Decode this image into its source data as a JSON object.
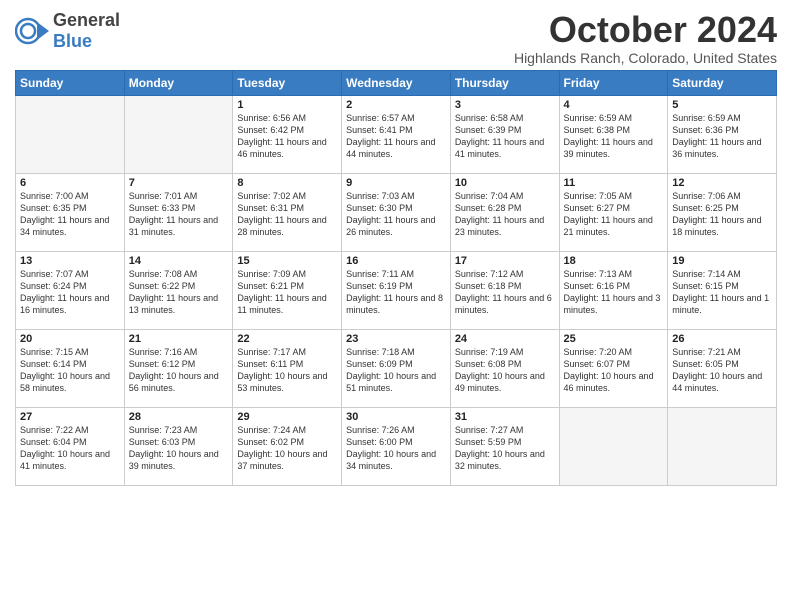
{
  "header": {
    "logo_general": "General",
    "logo_blue": "Blue",
    "month_title": "October 2024",
    "location": "Highlands Ranch, Colorado, United States"
  },
  "days_of_week": [
    "Sunday",
    "Monday",
    "Tuesday",
    "Wednesday",
    "Thursday",
    "Friday",
    "Saturday"
  ],
  "weeks": [
    [
      {
        "day": "",
        "empty": true
      },
      {
        "day": "",
        "empty": true
      },
      {
        "day": "1",
        "sunrise": "6:56 AM",
        "sunset": "6:42 PM",
        "daylight": "11 hours and 46 minutes."
      },
      {
        "day": "2",
        "sunrise": "6:57 AM",
        "sunset": "6:41 PM",
        "daylight": "11 hours and 44 minutes."
      },
      {
        "day": "3",
        "sunrise": "6:58 AM",
        "sunset": "6:39 PM",
        "daylight": "11 hours and 41 minutes."
      },
      {
        "day": "4",
        "sunrise": "6:59 AM",
        "sunset": "6:38 PM",
        "daylight": "11 hours and 39 minutes."
      },
      {
        "day": "5",
        "sunrise": "6:59 AM",
        "sunset": "6:36 PM",
        "daylight": "11 hours and 36 minutes."
      }
    ],
    [
      {
        "day": "6",
        "sunrise": "7:00 AM",
        "sunset": "6:35 PM",
        "daylight": "11 hours and 34 minutes."
      },
      {
        "day": "7",
        "sunrise": "7:01 AM",
        "sunset": "6:33 PM",
        "daylight": "11 hours and 31 minutes."
      },
      {
        "day": "8",
        "sunrise": "7:02 AM",
        "sunset": "6:31 PM",
        "daylight": "11 hours and 28 minutes."
      },
      {
        "day": "9",
        "sunrise": "7:03 AM",
        "sunset": "6:30 PM",
        "daylight": "11 hours and 26 minutes."
      },
      {
        "day": "10",
        "sunrise": "7:04 AM",
        "sunset": "6:28 PM",
        "daylight": "11 hours and 23 minutes."
      },
      {
        "day": "11",
        "sunrise": "7:05 AM",
        "sunset": "6:27 PM",
        "daylight": "11 hours and 21 minutes."
      },
      {
        "day": "12",
        "sunrise": "7:06 AM",
        "sunset": "6:25 PM",
        "daylight": "11 hours and 18 minutes."
      }
    ],
    [
      {
        "day": "13",
        "sunrise": "7:07 AM",
        "sunset": "6:24 PM",
        "daylight": "11 hours and 16 minutes."
      },
      {
        "day": "14",
        "sunrise": "7:08 AM",
        "sunset": "6:22 PM",
        "daylight": "11 hours and 13 minutes."
      },
      {
        "day": "15",
        "sunrise": "7:09 AM",
        "sunset": "6:21 PM",
        "daylight": "11 hours and 11 minutes."
      },
      {
        "day": "16",
        "sunrise": "7:11 AM",
        "sunset": "6:19 PM",
        "daylight": "11 hours and 8 minutes."
      },
      {
        "day": "17",
        "sunrise": "7:12 AM",
        "sunset": "6:18 PM",
        "daylight": "11 hours and 6 minutes."
      },
      {
        "day": "18",
        "sunrise": "7:13 AM",
        "sunset": "6:16 PM",
        "daylight": "11 hours and 3 minutes."
      },
      {
        "day": "19",
        "sunrise": "7:14 AM",
        "sunset": "6:15 PM",
        "daylight": "11 hours and 1 minute."
      }
    ],
    [
      {
        "day": "20",
        "sunrise": "7:15 AM",
        "sunset": "6:14 PM",
        "daylight": "10 hours and 58 minutes."
      },
      {
        "day": "21",
        "sunrise": "7:16 AM",
        "sunset": "6:12 PM",
        "daylight": "10 hours and 56 minutes."
      },
      {
        "day": "22",
        "sunrise": "7:17 AM",
        "sunset": "6:11 PM",
        "daylight": "10 hours and 53 minutes."
      },
      {
        "day": "23",
        "sunrise": "7:18 AM",
        "sunset": "6:09 PM",
        "daylight": "10 hours and 51 minutes."
      },
      {
        "day": "24",
        "sunrise": "7:19 AM",
        "sunset": "6:08 PM",
        "daylight": "10 hours and 49 minutes."
      },
      {
        "day": "25",
        "sunrise": "7:20 AM",
        "sunset": "6:07 PM",
        "daylight": "10 hours and 46 minutes."
      },
      {
        "day": "26",
        "sunrise": "7:21 AM",
        "sunset": "6:05 PM",
        "daylight": "10 hours and 44 minutes."
      }
    ],
    [
      {
        "day": "27",
        "sunrise": "7:22 AM",
        "sunset": "6:04 PM",
        "daylight": "10 hours and 41 minutes."
      },
      {
        "day": "28",
        "sunrise": "7:23 AM",
        "sunset": "6:03 PM",
        "daylight": "10 hours and 39 minutes."
      },
      {
        "day": "29",
        "sunrise": "7:24 AM",
        "sunset": "6:02 PM",
        "daylight": "10 hours and 37 minutes."
      },
      {
        "day": "30",
        "sunrise": "7:26 AM",
        "sunset": "6:00 PM",
        "daylight": "10 hours and 34 minutes."
      },
      {
        "day": "31",
        "sunrise": "7:27 AM",
        "sunset": "5:59 PM",
        "daylight": "10 hours and 32 minutes."
      },
      {
        "day": "",
        "empty": true
      },
      {
        "day": "",
        "empty": true
      }
    ]
  ]
}
